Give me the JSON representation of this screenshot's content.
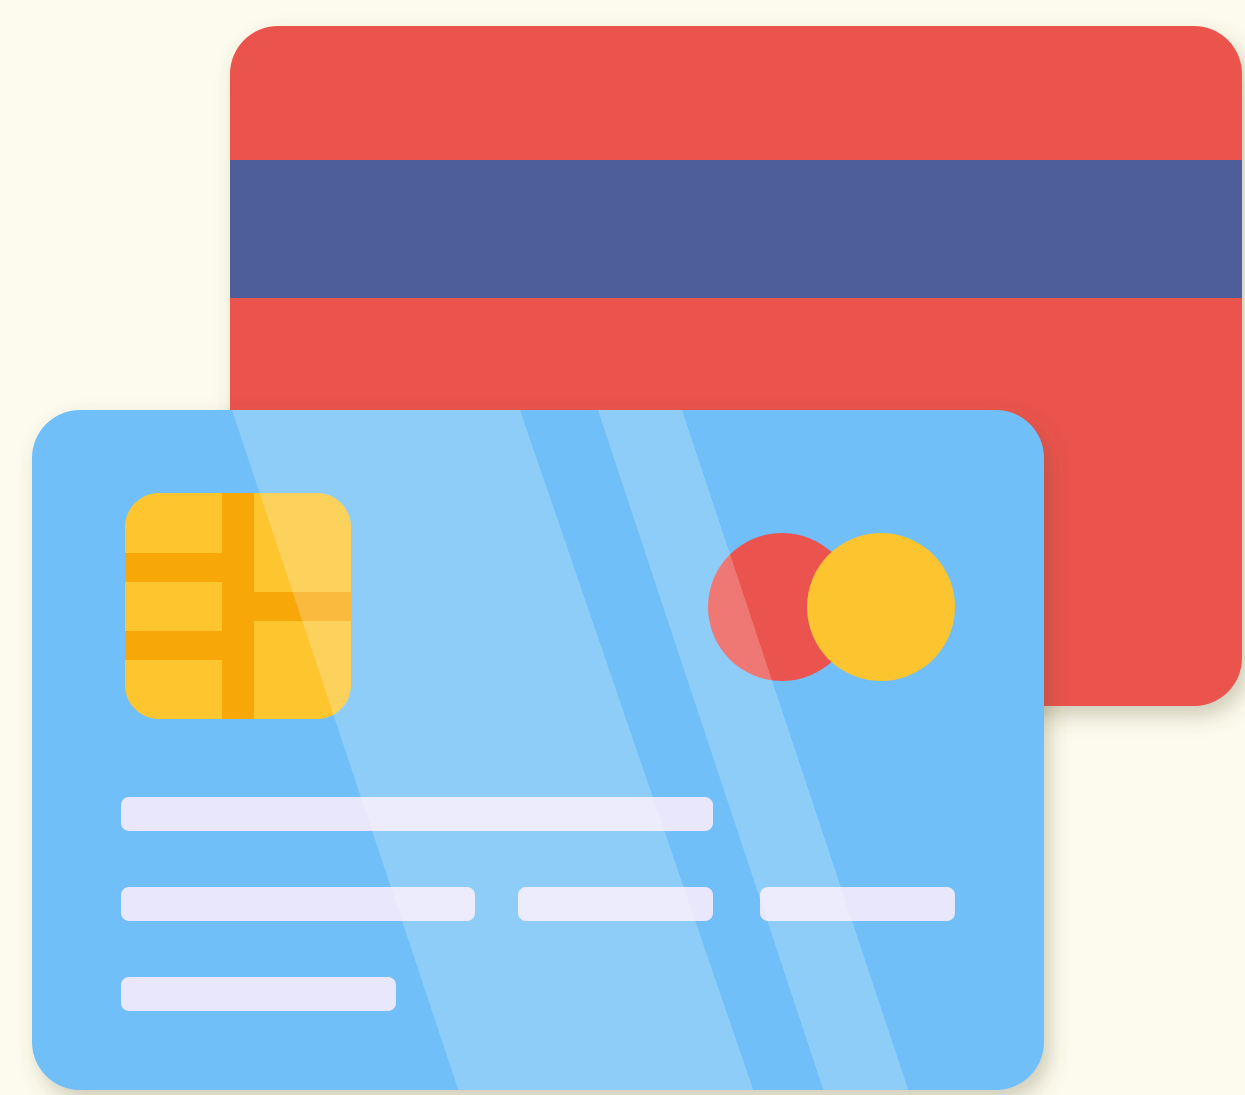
{
  "illustration": {
    "icon": "credit-cards-icon",
    "colors": {
      "background": "#fdfbee",
      "back_card": "#eb534e",
      "magnetic_stripe": "#4e5e9a",
      "front_card": "#70bff8",
      "glare": "#9dd2f8",
      "chip": "#fdc62f",
      "chip_lines": "#f8a708",
      "logo_left": "#eb534e",
      "logo_right": "#fcc52f",
      "text_bars": "#e8e7fb"
    }
  }
}
